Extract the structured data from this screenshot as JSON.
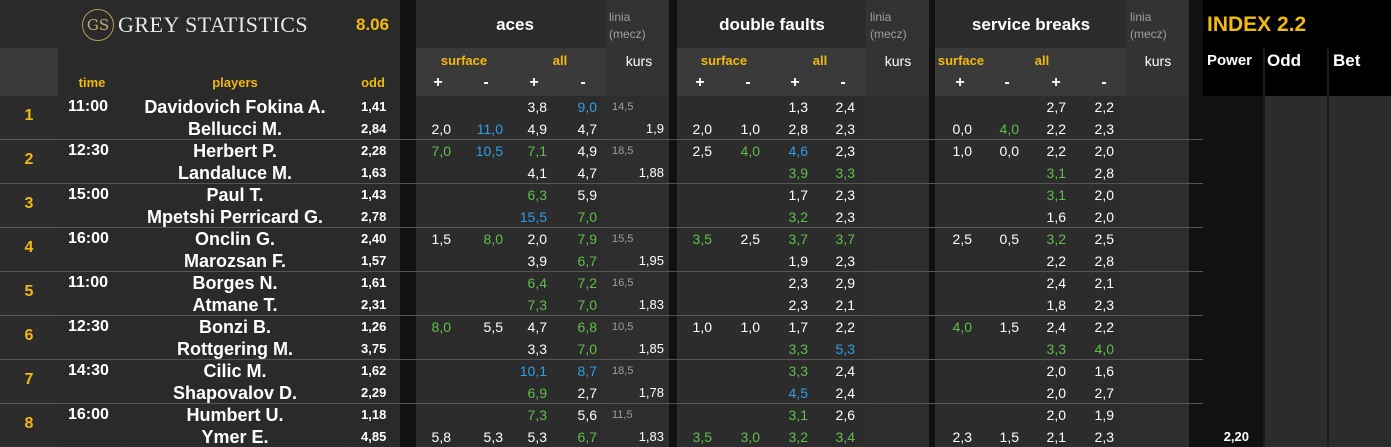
{
  "brand": {
    "monogram": "GS",
    "title": "GREY STATISTICS",
    "version": "8.06"
  },
  "index_title": "INDEX 2.2",
  "headers": {
    "time": "time",
    "players": "players",
    "odd": "odd",
    "aces": "aces",
    "double_faults": "double faults",
    "service_breaks": "service breaks",
    "linia": "linia",
    "mecz": "(mecz)",
    "surface": "surface",
    "all": "all",
    "kurs": "kurs",
    "plus": "+",
    "minus": "-",
    "power": "Power",
    "odd_col": "Odd",
    "bet": "Bet"
  },
  "colors": {
    "accent": "#f2b90f",
    "green": "#5fbf4a",
    "blue": "#2f9ee8",
    "background": "#1c1c1c"
  },
  "matches": [
    {
      "no": "1",
      "time": "11:00",
      "p1": {
        "name": "Davidovich Fokina A.",
        "odd": "1,41"
      },
      "p2": {
        "name": "Bellucci M.",
        "odd": "2,84"
      },
      "aces": {
        "s_plus": [
          "",
          "2,0"
        ],
        "s_minus": [
          "",
          "11,0"
        ],
        "a_plus": [
          "3,8",
          "4,9"
        ],
        "a_minus": [
          "9,0",
          "4,7"
        ],
        "linia": "14,5",
        "kurs": "1,9"
      },
      "df": {
        "s_plus": [
          "",
          "2,0"
        ],
        "s_minus": [
          "",
          "1,0"
        ],
        "a_plus": [
          "1,3",
          "2,8"
        ],
        "a_minus": [
          "2,4",
          "2,3"
        ]
      },
      "sb": {
        "s_plus": [
          "",
          "0,0"
        ],
        "s_minus": [
          "",
          "4,0"
        ],
        "a_plus": [
          "2,7",
          "2,2"
        ],
        "a_minus": [
          "2,2",
          "2,3"
        ]
      },
      "power": ""
    },
    {
      "no": "2",
      "time": "12:30",
      "p1": {
        "name": "Herbert P.",
        "odd": "2,28"
      },
      "p2": {
        "name": "Landaluce M.",
        "odd": "1,63"
      },
      "aces": {
        "s_plus": [
          "7,0",
          ""
        ],
        "s_minus": [
          "10,5",
          ""
        ],
        "a_plus": [
          "7,1",
          "4,1"
        ],
        "a_minus": [
          "4,9",
          "4,7"
        ],
        "linia": "18,5",
        "kurs": "1,88"
      },
      "df": {
        "s_plus": [
          "2,5",
          ""
        ],
        "s_minus": [
          "4,0",
          ""
        ],
        "a_plus": [
          "4,6",
          "3,9"
        ],
        "a_minus": [
          "2,3",
          "3,3"
        ]
      },
      "sb": {
        "s_plus": [
          "1,0",
          ""
        ],
        "s_minus": [
          "0,0",
          ""
        ],
        "a_plus": [
          "2,2",
          "3,1"
        ],
        "a_minus": [
          "2,0",
          "2,8"
        ]
      },
      "power": ""
    },
    {
      "no": "3",
      "time": "15:00",
      "p1": {
        "name": "Paul T.",
        "odd": "1,43"
      },
      "p2": {
        "name": "Mpetshi Perricard G.",
        "odd": "2,78"
      },
      "aces": {
        "s_plus": [
          "",
          ""
        ],
        "s_minus": [
          "",
          ""
        ],
        "a_plus": [
          "6,3",
          "15,5"
        ],
        "a_minus": [
          "5,9",
          "7,0"
        ],
        "linia": "",
        "kurs": ""
      },
      "df": {
        "s_plus": [
          "",
          ""
        ],
        "s_minus": [
          "",
          ""
        ],
        "a_plus": [
          "1,7",
          "3,2"
        ],
        "a_minus": [
          "2,3",
          "2,3"
        ]
      },
      "sb": {
        "s_plus": [
          "",
          ""
        ],
        "s_minus": [
          "",
          ""
        ],
        "a_plus": [
          "3,1",
          "1,6"
        ],
        "a_minus": [
          "2,0",
          "2,0"
        ]
      },
      "power": ""
    },
    {
      "no": "4",
      "time": "16:00",
      "p1": {
        "name": "Onclin G.",
        "odd": "2,40"
      },
      "p2": {
        "name": "Marozsan F.",
        "odd": "1,57"
      },
      "aces": {
        "s_plus": [
          "1,5",
          ""
        ],
        "s_minus": [
          "8,0",
          ""
        ],
        "a_plus": [
          "2,0",
          "3,9"
        ],
        "a_minus": [
          "7,9",
          "6,7"
        ],
        "linia": "15,5",
        "kurs": "1,95"
      },
      "df": {
        "s_plus": [
          "3,5",
          ""
        ],
        "s_minus": [
          "2,5",
          ""
        ],
        "a_plus": [
          "3,7",
          "1,9"
        ],
        "a_minus": [
          "3,7",
          "2,3"
        ]
      },
      "sb": {
        "s_plus": [
          "2,5",
          ""
        ],
        "s_minus": [
          "0,5",
          ""
        ],
        "a_plus": [
          "3,2",
          "2,2"
        ],
        "a_minus": [
          "2,5",
          "2,8"
        ]
      },
      "power": ""
    },
    {
      "no": "5",
      "time": "11:00",
      "p1": {
        "name": "Borges N.",
        "odd": "1,61"
      },
      "p2": {
        "name": "Atmane T.",
        "odd": "2,31"
      },
      "aces": {
        "s_plus": [
          "",
          ""
        ],
        "s_minus": [
          "",
          ""
        ],
        "a_plus": [
          "6,4",
          "7,3"
        ],
        "a_minus": [
          "7,2",
          "7,0"
        ],
        "linia": "16,5",
        "kurs": "1,83"
      },
      "df": {
        "s_plus": [
          "",
          ""
        ],
        "s_minus": [
          "",
          ""
        ],
        "a_plus": [
          "2,3",
          "2,3"
        ],
        "a_minus": [
          "2,9",
          "2,1"
        ]
      },
      "sb": {
        "s_plus": [
          "",
          ""
        ],
        "s_minus": [
          "",
          ""
        ],
        "a_plus": [
          "2,4",
          "1,8"
        ],
        "a_minus": [
          "2,1",
          "2,3"
        ]
      },
      "power": ""
    },
    {
      "no": "6",
      "time": "12:30",
      "p1": {
        "name": "Bonzi B.",
        "odd": "1,26"
      },
      "p2": {
        "name": "Rottgering M.",
        "odd": "3,75"
      },
      "aces": {
        "s_plus": [
          "8,0",
          ""
        ],
        "s_minus": [
          "5,5",
          ""
        ],
        "a_plus": [
          "4,7",
          "3,3"
        ],
        "a_minus": [
          "6,8",
          "7,0"
        ],
        "linia": "10,5",
        "kurs": "1,85"
      },
      "df": {
        "s_plus": [
          "1,0",
          ""
        ],
        "s_minus": [
          "1,0",
          ""
        ],
        "a_plus": [
          "1,7",
          "3,3"
        ],
        "a_minus": [
          "2,2",
          "5,3"
        ]
      },
      "sb": {
        "s_plus": [
          "4,0",
          ""
        ],
        "s_minus": [
          "1,5",
          ""
        ],
        "a_plus": [
          "2,4",
          "3,3"
        ],
        "a_minus": [
          "2,2",
          "4,0"
        ]
      },
      "power": ""
    },
    {
      "no": "7",
      "time": "14:30",
      "p1": {
        "name": "Cilic M.",
        "odd": "1,62"
      },
      "p2": {
        "name": "Shapovalov D.",
        "odd": "2,29"
      },
      "aces": {
        "s_plus": [
          "",
          ""
        ],
        "s_minus": [
          "",
          ""
        ],
        "a_plus": [
          "10,1",
          "6,9"
        ],
        "a_minus": [
          "8,7",
          "2,7"
        ],
        "linia": "18,5",
        "kurs": "1,78"
      },
      "df": {
        "s_plus": [
          "",
          ""
        ],
        "s_minus": [
          "",
          ""
        ],
        "a_plus": [
          "3,3",
          "4,5"
        ],
        "a_minus": [
          "2,4",
          "2,4"
        ]
      },
      "sb": {
        "s_plus": [
          "",
          ""
        ],
        "s_minus": [
          "",
          ""
        ],
        "a_plus": [
          "2,0",
          "2,0"
        ],
        "a_minus": [
          "1,6",
          "2,7"
        ]
      },
      "power": ""
    },
    {
      "no": "8",
      "time": "16:00",
      "p1": {
        "name": "Humbert U.",
        "odd": "1,18"
      },
      "p2": {
        "name": "Ymer E.",
        "odd": "4,85"
      },
      "aces": {
        "s_plus": [
          "",
          "5,8"
        ],
        "s_minus": [
          "",
          "5,3"
        ],
        "a_plus": [
          "7,3",
          "5,3"
        ],
        "a_minus": [
          "5,6",
          "6,7"
        ],
        "linia": "11,5",
        "kurs": "1,83"
      },
      "df": {
        "s_plus": [
          "",
          "3,5"
        ],
        "s_minus": [
          "",
          "3,0"
        ],
        "a_plus": [
          "3,1",
          "3,2"
        ],
        "a_minus": [
          "2,6",
          "3,4"
        ]
      },
      "sb": {
        "s_plus": [
          "",
          "2,3"
        ],
        "s_minus": [
          "",
          "1,5"
        ],
        "a_plus": [
          "2,0",
          "2,1"
        ],
        "a_minus": [
          "1,9",
          "2,3"
        ]
      },
      "power": "2,20"
    }
  ],
  "cell_colors": {
    "1": {
      "aces.a_minus.0": "blue",
      "aces.s_minus.1": "blue",
      "sb.s_minus.1": "green"
    },
    "2": {
      "aces.s_plus.0": "green",
      "aces.s_minus.0": "blue",
      "aces.a_plus.0": "green",
      "df.s_minus.0": "green",
      "df.a_plus.0": "blue",
      "df.a_plus.1": "green",
      "df.a_minus.1": "green",
      "sb.a_plus.1": "green"
    },
    "3": {
      "aces.a_plus.0": "green",
      "aces.a_plus.1": "blue",
      "aces.a_minus.1": "green",
      "df.a_plus.1": "green",
      "sb.a_plus.0": "green"
    },
    "4": {
      "aces.s_minus.0": "green",
      "aces.a_minus.0": "green",
      "aces.a_minus.1": "green",
      "df.s_plus.0": "green",
      "df.a_plus.0": "green",
      "df.a_minus.0": "green",
      "sb.a_plus.0": "green"
    },
    "5": {
      "aces.a_plus.0": "green",
      "aces.a_minus.0": "green",
      "aces.a_plus.1": "green",
      "aces.a_minus.1": "green"
    },
    "6": {
      "aces.s_plus.0": "green",
      "aces.a_minus.0": "green",
      "aces.a_minus.1": "green",
      "df.a_plus.1": "green",
      "df.a_minus.1": "blue",
      "sb.s_plus.0": "green",
      "sb.a_plus.1": "green",
      "sb.a_minus.1": "green"
    },
    "7": {
      "aces.a_plus.0": "blue",
      "aces.a_minus.0": "blue",
      "aces.a_plus.1": "green",
      "df.a_plus.0": "green",
      "df.a_plus.1": "blue"
    },
    "8": {
      "aces.a_plus.0": "green",
      "aces.a_minus.1": "green",
      "df.s_plus.1": "green",
      "df.s_minus.1": "green",
      "df.a_plus.0": "green",
      "df.a_plus.1": "green",
      "df.a_minus.1": "green"
    }
  }
}
